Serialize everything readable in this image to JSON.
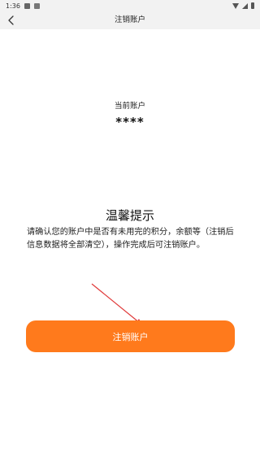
{
  "status_bar": {
    "time": "1:36"
  },
  "header": {
    "title": "注销账户"
  },
  "account": {
    "label": "当前账户",
    "value": "****"
  },
  "notice": {
    "title": "温馨提示",
    "body": "请确认您的账户中是否有未用完的积分，余额等（注销后信息数据将全部清空），操作完成后可注销账户。"
  },
  "action": {
    "cancel_label": "注销账户"
  },
  "colors": {
    "accent": "#ff7a1c",
    "annotation_arrow": "#e03a3a",
    "header_bg": "#f2f2f2"
  }
}
